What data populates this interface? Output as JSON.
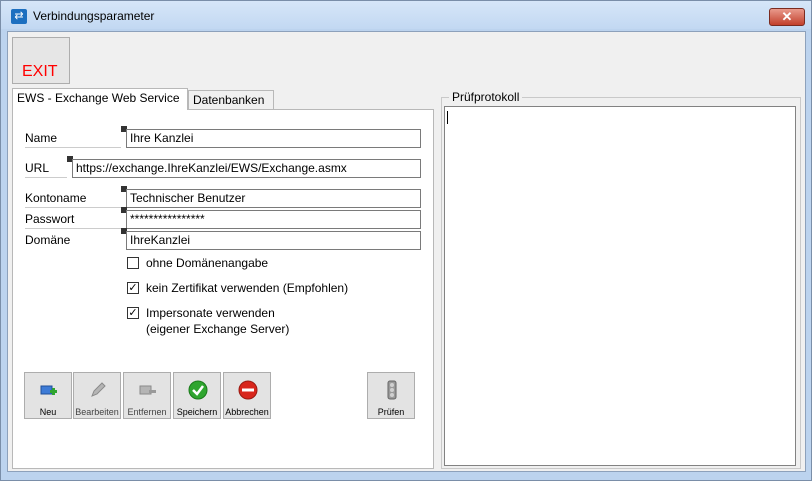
{
  "window": {
    "title": "Verbindungsparameter",
    "app_icon": "transfer-arrows-icon",
    "close_icon": "close-icon"
  },
  "toolbar": {
    "exit_label": "EXIT"
  },
  "tabs": [
    {
      "label": "EWS - Exchange Web Service",
      "active": true
    },
    {
      "label": "Datenbanken",
      "active": false
    }
  ],
  "form": {
    "name": {
      "label": "Name",
      "value": "Ihre Kanzlei"
    },
    "url": {
      "label": "URL",
      "value": "https://exchange.IhreKanzlei/EWS/Exchange.asmx"
    },
    "account": {
      "label": "Kontoname",
      "value": "Technischer Benutzer"
    },
    "password": {
      "label": "Passwort",
      "value": "****************"
    },
    "domain": {
      "label": "Domäne",
      "value": "IhreKanzlei"
    }
  },
  "checkboxes": [
    {
      "label": "ohne Domänenangabe",
      "checked": false,
      "mark": ""
    },
    {
      "label": "kein Zertifikat verwenden (Empfohlen)",
      "checked": true,
      "mark": "✓"
    },
    {
      "label": "Impersonate verwenden",
      "label2": "(eigener Exchange Server)",
      "checked": true,
      "mark": "✓"
    }
  ],
  "buttons": {
    "new": {
      "label": "Neu",
      "icon": "new-record-icon"
    },
    "edit": {
      "label": "Bearbeiten",
      "icon": "edit-pencil-icon",
      "enabled": false
    },
    "remove": {
      "label": "Entfernen",
      "icon": "remove-record-icon",
      "enabled": false
    },
    "save": {
      "label": "Speichern",
      "icon": "checkmark-icon"
    },
    "cancel": {
      "label": "Abbrechen",
      "icon": "cancel-icon"
    },
    "test": {
      "label": "Prüfen",
      "icon": "traffic-light-icon"
    }
  },
  "log": {
    "title": "Prüfprotokoll",
    "content": ""
  },
  "colors": {
    "exit_text": "#ff0000",
    "save_green": "#2fa52f",
    "cancel_red": "#d8261c",
    "close_red": "#c2402c"
  }
}
